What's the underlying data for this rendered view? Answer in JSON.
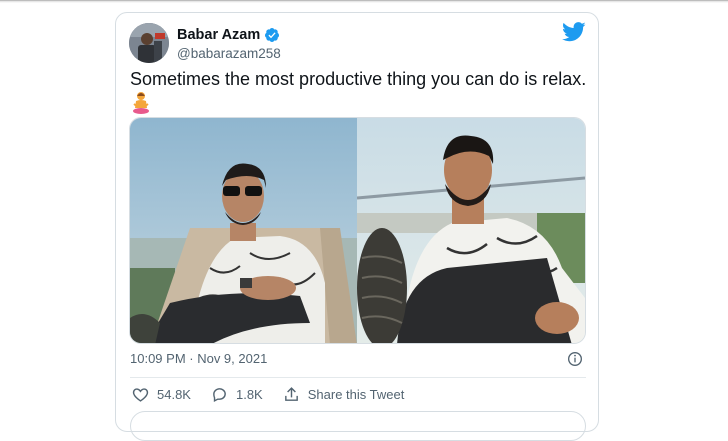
{
  "tweet": {
    "author_name": "Babar Azam",
    "author_handle": "@babarazam258",
    "text": "Sometimes the most productive thing you can do is relax.",
    "emoji": "🧘",
    "timestamp": "10:09 PM · Nov 9, 2021",
    "likes": "54.8K",
    "replies": "1.8K",
    "share_label": "Share this Tweet"
  },
  "icons": {
    "verified": "verified-badge-icon",
    "logo": "twitter-bird-icon",
    "info": "info-icon",
    "like": "heart-icon",
    "reply": "reply-bubble-icon",
    "share": "share-upload-icon"
  },
  "colors": {
    "brand_blue": "#1d9bf0",
    "text_primary": "#0f1419",
    "text_secondary": "#536471",
    "border": "#d6dde2"
  }
}
